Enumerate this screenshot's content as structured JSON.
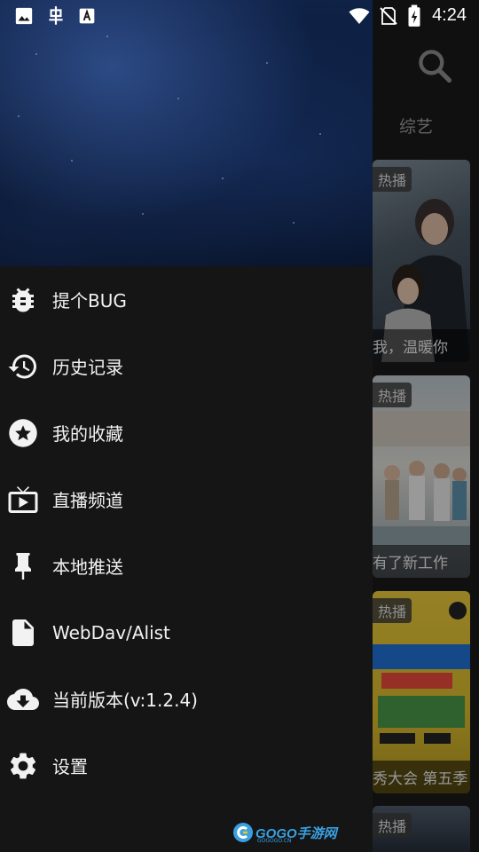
{
  "status_bar": {
    "time": "4:24",
    "icons": [
      "image-icon",
      "bug-notification-icon",
      "a-icon",
      "wifi-icon",
      "no-sim-icon",
      "battery-icon"
    ]
  },
  "background": {
    "search_icon": "search-icon",
    "tab_label": "综艺",
    "cards": [
      {
        "badge": "热播",
        "caption": "我，温暖你"
      },
      {
        "badge": "热播",
        "caption": "有了新工作"
      },
      {
        "badge": "热播",
        "caption": "秀大会 第五季"
      },
      {
        "badge": "热播",
        "caption": ""
      }
    ]
  },
  "drawer": {
    "menu": [
      {
        "icon": "bug-icon",
        "label": "提个BUG"
      },
      {
        "icon": "history-icon",
        "label": "历史记录"
      },
      {
        "icon": "star-icon",
        "label": "我的收藏"
      },
      {
        "icon": "tv-icon",
        "label": "直播频道"
      },
      {
        "icon": "pin-icon",
        "label": "本地推送"
      },
      {
        "icon": "file-icon",
        "label": "WebDav/Alist"
      },
      {
        "icon": "cloud-download-icon",
        "label": "当前版本(v:1.2.4)"
      },
      {
        "icon": "gear-icon",
        "label": "设置"
      }
    ]
  },
  "watermark": {
    "text": "GOGO手游网",
    "sub": "GOGOGO.CN"
  },
  "colors": {
    "drawer_bg": "#151515",
    "header_blue": "#0f2247",
    "watermark": "#3aa0e0"
  }
}
